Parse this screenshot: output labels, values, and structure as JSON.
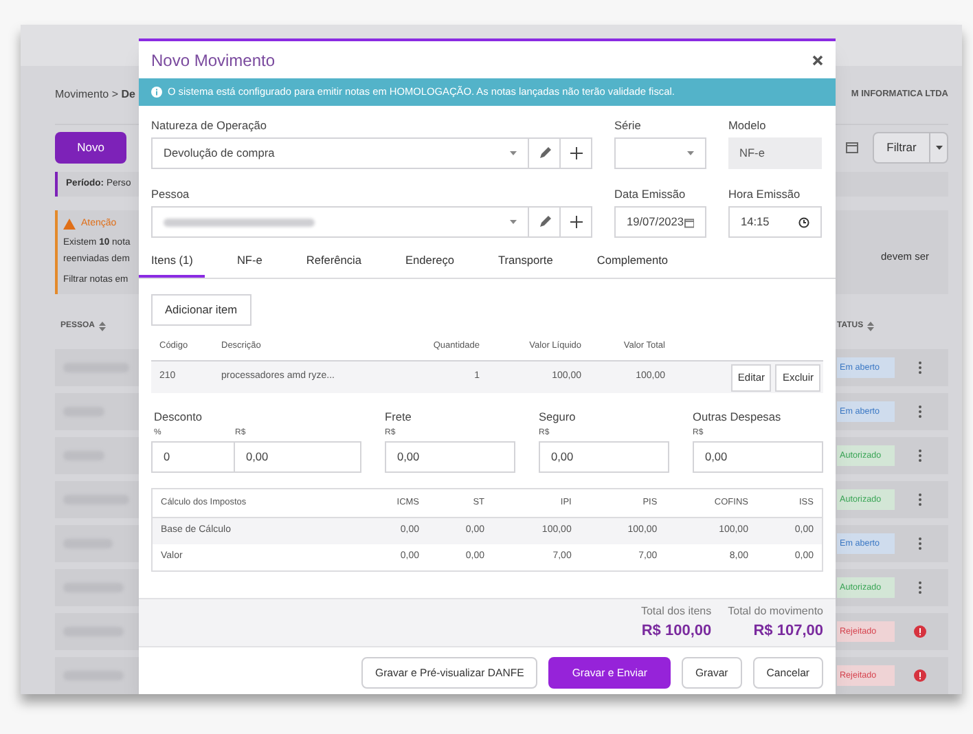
{
  "background": {
    "breadcrumb": "Movimento > **De**",
    "company": "M INFORMATICA LTDA",
    "new_button": "Novo",
    "filter_button": "Filtrar",
    "period": "**Período:** Perso",
    "alert": {
      "title": "Atenção",
      "lines": [
        "Existem **10** nota",
        "reenviadas dem",
        "Filtrar notas em"
      ],
      "right_text": "devem ser"
    },
    "columns": [
      "PESSOA",
      "TATUS"
    ],
    "rows": [
      {
        "status": "Em aberto",
        "kind": "open"
      },
      {
        "status": "Em aberto",
        "kind": "open"
      },
      {
        "status": "Autorizado",
        "kind": "authorized"
      },
      {
        "status": "Autorizado",
        "kind": "authorized"
      },
      {
        "status": "Em aberto",
        "kind": "open"
      },
      {
        "status": "Autorizado",
        "kind": "authorized"
      },
      {
        "status": "Rejeitado",
        "kind": "rejected"
      },
      {
        "status": "Rejeitado",
        "kind": "rejected"
      }
    ]
  },
  "modal": {
    "title": "Novo Movimento",
    "notice": "O sistema está configurado para emitir notas em HOMOLOGAÇÃO. As notas lançadas não terão validade fiscal.",
    "fields": {
      "operation_label": "Natureza de Operação",
      "operation_value": "Devolução de compra",
      "series_label": "Série",
      "model_label": "Modelo",
      "model_value": "NF-e",
      "person_label": "Pessoa",
      "date_label": "Data Emissão",
      "date_value": "19/07/2023",
      "time_label": "Hora Emissão",
      "time_value": "14:15"
    },
    "tabs": [
      {
        "label": "Itens (1)",
        "selected": true
      },
      {
        "label": "NF-e",
        "selected": false
      },
      {
        "label": "Referência",
        "selected": false
      },
      {
        "label": "Endereço",
        "selected": false
      },
      {
        "label": "Transporte",
        "selected": false
      },
      {
        "label": "Complemento",
        "selected": false
      }
    ],
    "add_item": "Adicionar item",
    "items": {
      "columns": [
        "Código",
        "Descrição",
        "Quantidade",
        "Valor Líquido",
        "Valor Total"
      ],
      "rows": [
        {
          "cells": [
            "210",
            "processadores amd ryze...",
            "1",
            "100,00",
            "100,00"
          ],
          "actions": [
            "Editar",
            "Excluir"
          ]
        }
      ]
    },
    "discount": {
      "label": "Desconto",
      "percent_label": "%",
      "percent_value": "0",
      "amount_label": "R$",
      "amount_value": "0,00"
    },
    "extras": [
      {
        "label": "Frete",
        "currency": "R$",
        "value": "0,00"
      },
      {
        "label": "Seguro",
        "currency": "R$",
        "value": "0,00"
      },
      {
        "label": "Outras Despesas",
        "currency": "R$",
        "value": "0,00"
      }
    ],
    "taxes": {
      "columns": [
        "Cálculo dos Impostos",
        "ICMS",
        "ST",
        "IPI",
        "PIS",
        "COFINS",
        "ISS"
      ],
      "rows": [
        [
          "Base de Cálculo",
          "0,00",
          "0,00",
          "100,00",
          "100,00",
          "100,00",
          "0,00"
        ],
        [
          "Valor",
          "0,00",
          "0,00",
          "7,00",
          "7,00",
          "8,00",
          "0,00"
        ]
      ]
    },
    "totals": [
      {
        "label": "Total dos itens",
        "value": "R$ 100,00"
      },
      {
        "label": "Total do movimento",
        "value": "R$ 107,00"
      }
    ],
    "buttons": [
      {
        "label": "Gravar e Pré-visualizar DANFE",
        "kind": "default"
      },
      {
        "label": "Gravar e Enviar",
        "kind": "primary"
      },
      {
        "label": "Gravar",
        "kind": "default"
      },
      {
        "label": "Cancelar",
        "kind": "default"
      }
    ]
  }
}
